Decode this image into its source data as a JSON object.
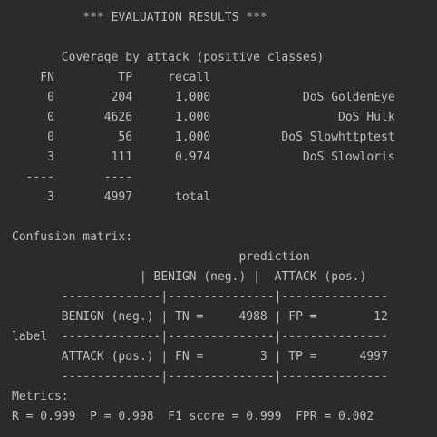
{
  "console": {
    "lines": [
      "          *** EVALUATION RESULTS ***",
      "",
      "       Coverage by attack (positive classes)",
      "    FN         TP     recall",
      "     0        204      1.000             DoS GoldenEye",
      "     0       4626      1.000                  DoS Hulk",
      "     0         56      1.000          DoS Slowhttptest",
      "     3        111      0.974             DoS Slowloris",
      "  ----       ----",
      "     3       4997      total",
      "",
      "Confusion matrix:",
      "                                prediction",
      "                  | BENIGN (neg.) |  ATTACK (pos.)",
      "       --------------|---------------|---------------",
      "       BENIGN (neg.) | TN =     4988 | FP =        12",
      "label  --------------|---------------|---------------",
      "       ATTACK (pos.) | FN =        3 | TP =      4997",
      "       --------------|---------------|---------------",
      "Metrics:",
      "R = 0.999  P = 0.998  F1 score = 0.999  FPR = 0.002"
    ]
  }
}
